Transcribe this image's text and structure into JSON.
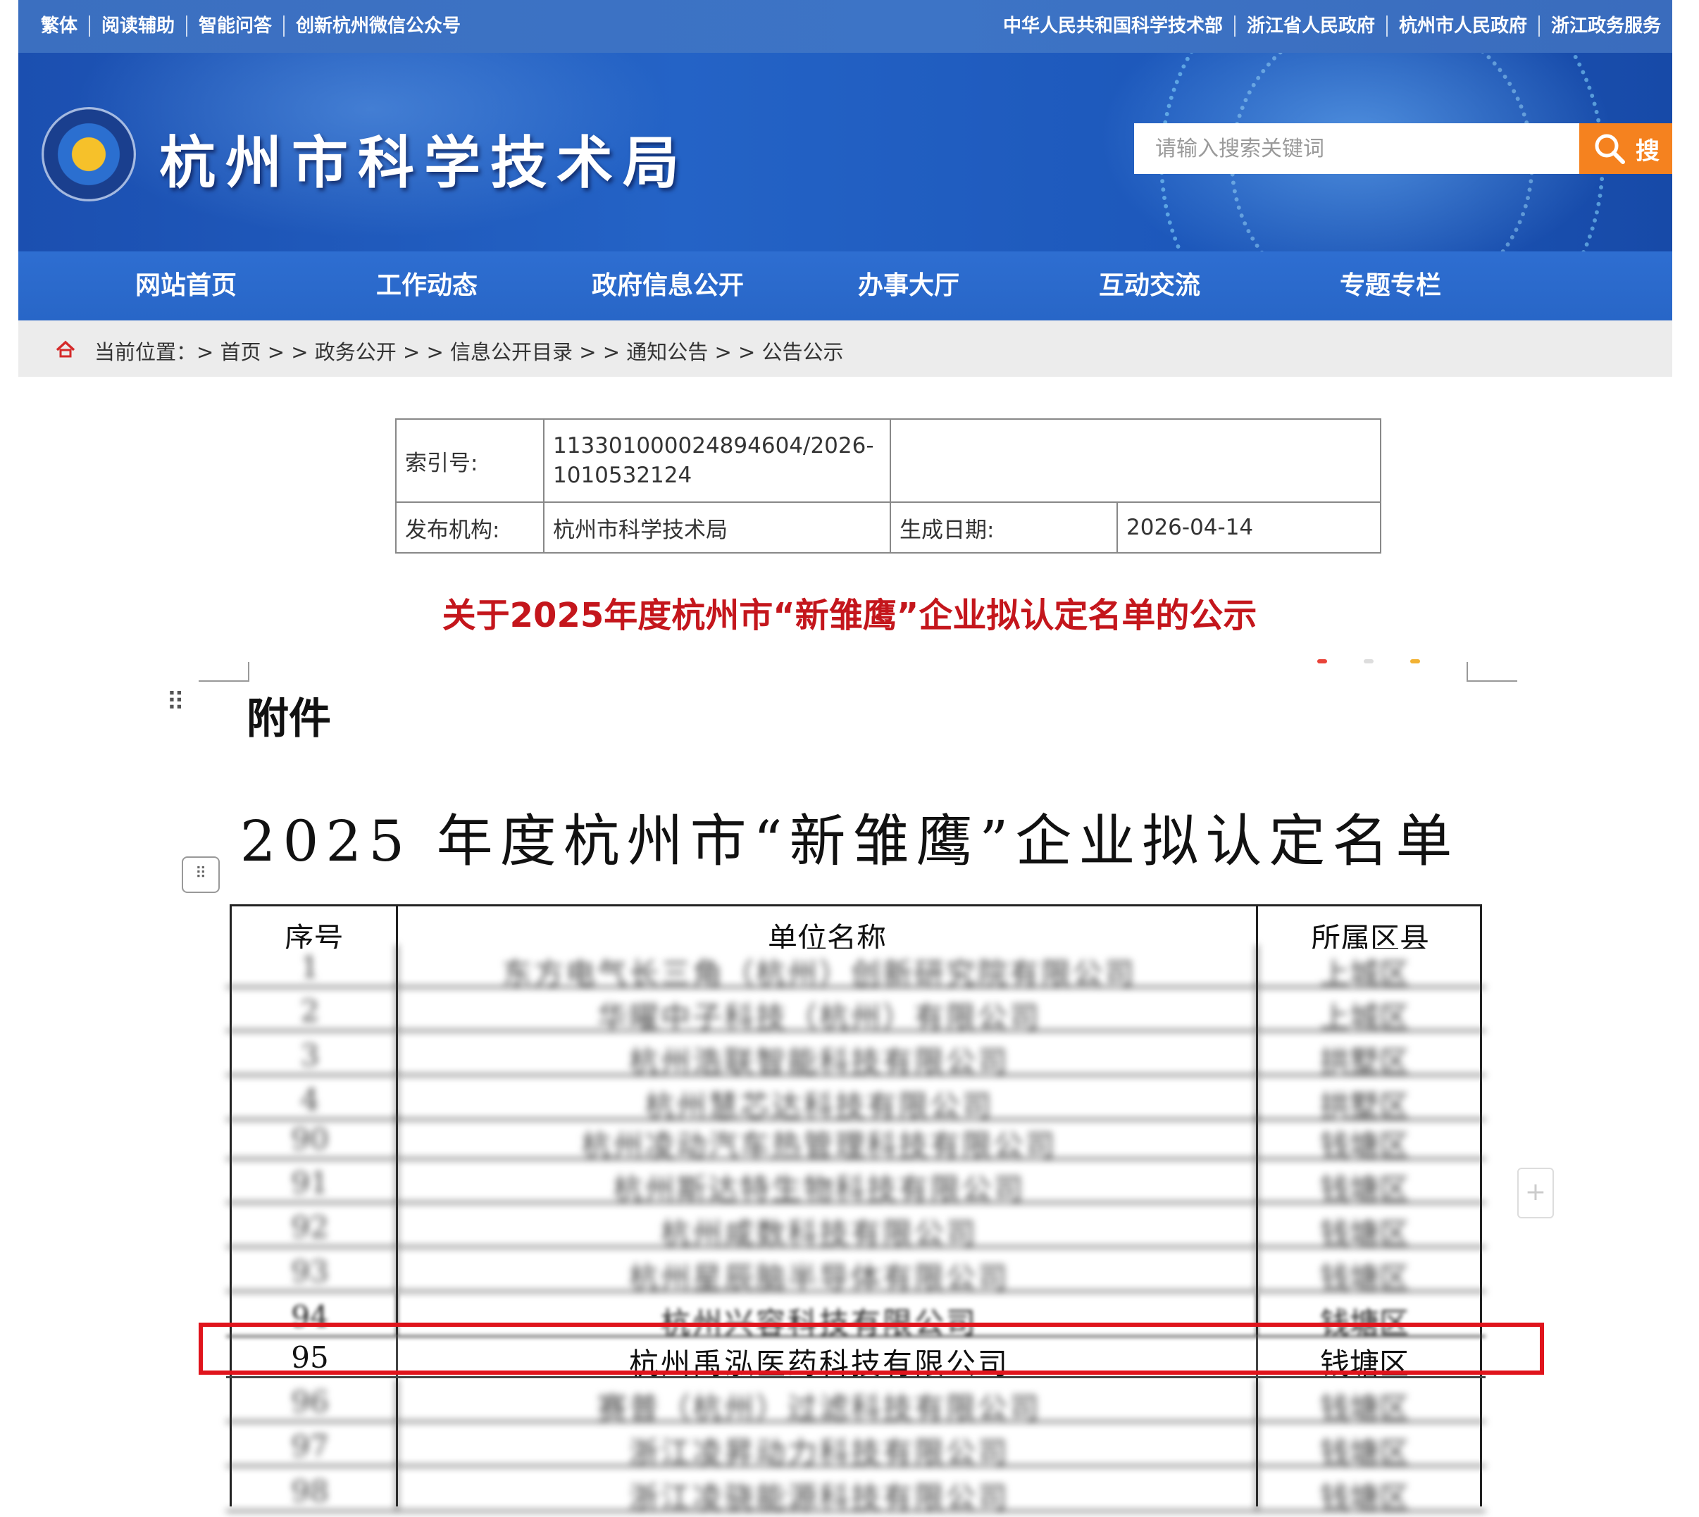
{
  "topbar": {
    "left_links": [
      "繁体",
      "阅读辅助",
      "智能问答",
      "创新杭州微信公众号"
    ],
    "right_links": [
      "中华人民共和国科学技术部",
      "浙江省人民政府",
      "杭州市人民政府",
      "浙江政务服务"
    ]
  },
  "header": {
    "site_title": "杭州市科学技术局",
    "search_placeholder": "请输入搜索关键词",
    "search_button": "搜"
  },
  "nav": {
    "items": [
      "网站首页",
      "工作动态",
      "政府信息公开",
      "办事大厅",
      "互动交流",
      "专题专栏"
    ]
  },
  "breadcrumb": {
    "text": "当前位置：> 首页 > > 政务公开 > > 信息公开目录 > > 通知公告 > > 公告公示"
  },
  "meta": {
    "index_label": "索引号:",
    "index_value_line1": "113301000024894604/2026-",
    "index_value_line2": "1010532124",
    "publisher_label": "发布机构:",
    "publisher_value": "杭州市科学技术局",
    "date_label": "生成日期:",
    "date_value": "2026-04-14"
  },
  "article": {
    "headline": "关于2025年度杭州市“新雏鹰”企业拟认定名单的公示"
  },
  "attachment": {
    "label": "附件",
    "list_title": "2025 年度杭州市“新雏鹰”企业拟认定名单",
    "columns": [
      "序号",
      "单位名称",
      "所属区县"
    ],
    "rows": [
      {
        "no": "1",
        "name": "东方电气长三角（杭州）创新研究院有限公司",
        "district": "上城区"
      },
      {
        "no": "2",
        "name": "华曜中子科技（杭州）有限公司",
        "district": "上城区"
      },
      {
        "no": "3",
        "name": "杭州浩联智能科技有限公司",
        "district": "拱墅区"
      },
      {
        "no": "4",
        "name": "杭州慧芯达科技有限公司",
        "district": "拱墅区"
      },
      {
        "no": "90",
        "name": "杭州凌动汽车热管理科技有限公司",
        "district": "钱塘区"
      },
      {
        "no": "91",
        "name": "杭州斯达特生物科技有限公司",
        "district": "钱塘区"
      },
      {
        "no": "92",
        "name": "杭州咸数科技有限公司",
        "district": "钱塘区"
      },
      {
        "no": "93",
        "name": "杭州星辰脑半导体有限公司",
        "district": "钱塘区"
      },
      {
        "no": "94",
        "name": "杭州兴容科技有限公司",
        "district": "钱塘区"
      },
      {
        "no": "95",
        "name": "杭州禹泓医药科技有限公司",
        "district": "钱塘区"
      },
      {
        "no": "96",
        "name": "赛普（杭州）过滤科技有限公司",
        "district": "钱塘区"
      },
      {
        "no": "97",
        "name": "浙江凌昇动力科技有限公司",
        "district": "钱塘区"
      },
      {
        "no": "98",
        "name": "浙江凌骁能源科技有限公司",
        "district": "钱塘区"
      }
    ],
    "highlighted_no": "95"
  },
  "colors": {
    "brand_blue": "#2866c7",
    "search_orange": "#f5821f",
    "headline_red": "#c4161c",
    "highlight_red": "#e0141c"
  },
  "icons": {
    "search": "search-icon",
    "home": "home-icon",
    "drag": "drag-handle-icon",
    "add": "plus-icon"
  }
}
